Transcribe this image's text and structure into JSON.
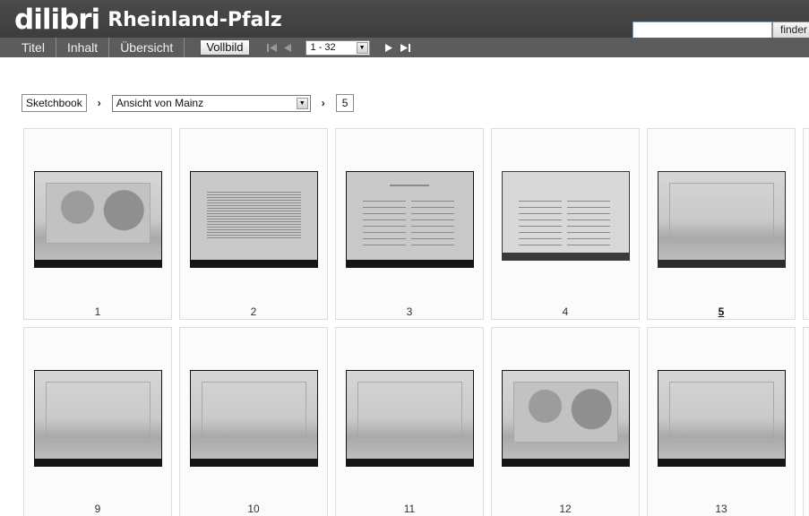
{
  "header": {
    "logo_mark": "dilibri",
    "logo_name": "Rheinland-Pfalz",
    "search": {
      "value": "",
      "button_label": "finder"
    }
  },
  "navbar": {
    "tabs": [
      "Titel",
      "Inhalt",
      "Übersicht"
    ],
    "fullscreen_label": "Vollbild",
    "page_range": "1 - 32"
  },
  "breadcrumb": {
    "root": "Sketchbook",
    "separator": "›",
    "chapter": "Ansicht von Mainz",
    "page": "5"
  },
  "thumbnails": [
    {
      "label": "1",
      "kind": "landscape-trees"
    },
    {
      "label": "2",
      "kind": "text-page"
    },
    {
      "label": "3",
      "kind": "index-page"
    },
    {
      "label": "4",
      "kind": "index-page-light"
    },
    {
      "label": "5",
      "kind": "landscape",
      "current": true
    },
    {
      "label": "9",
      "kind": "landscape"
    },
    {
      "label": "10",
      "kind": "landscape"
    },
    {
      "label": "11",
      "kind": "landscape"
    },
    {
      "label": "12",
      "kind": "landscape-temple"
    },
    {
      "label": "13",
      "kind": "landscape"
    }
  ],
  "colors": {
    "header_bg": "#474747",
    "navbar_bg": "#5c5c5c",
    "tile_border": "#dddddd"
  }
}
